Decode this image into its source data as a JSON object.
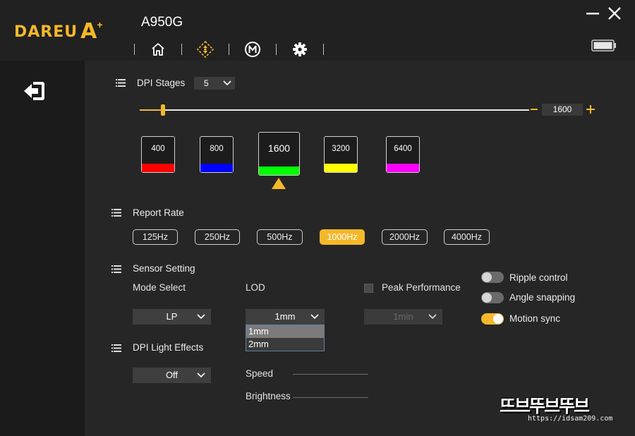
{
  "brand": {
    "logo_text": "DAREU",
    "logo_mark": "A",
    "logo_plus": "+",
    "accent": "#f5b82a"
  },
  "header": {
    "model": "A950G"
  },
  "nav": [
    {
      "name": "home-icon"
    },
    {
      "name": "dpi-icon",
      "active": true
    },
    {
      "name": "macro-icon"
    },
    {
      "name": "settings-icon"
    }
  ],
  "dpi": {
    "label": "DPI Stages",
    "stage_count": "5",
    "current_value": "1600",
    "slider_fraction": 0.06,
    "stages": [
      {
        "value": "400",
        "color": "#ff0000"
      },
      {
        "value": "800",
        "color": "#0000ff"
      },
      {
        "value": "1600",
        "color": "#00ff00",
        "selected": true
      },
      {
        "value": "3200",
        "color": "#ffff00"
      },
      {
        "value": "6400",
        "color": "#ff00ff"
      }
    ]
  },
  "report_rate": {
    "label": "Report Rate",
    "options": [
      "125Hz",
      "250Hz",
      "500Hz",
      "1000Hz",
      "2000Hz",
      "4000Hz"
    ],
    "selected": "1000Hz"
  },
  "sensor": {
    "label": "Sensor Setting",
    "mode_label": "Mode Select",
    "mode_value": "LP",
    "lod_label": "LOD",
    "lod_value": "1mm",
    "lod_options": [
      "1mm",
      "2mm"
    ],
    "peak_label": "Peak Performance",
    "peak_checked": false,
    "peak_value": "1min"
  },
  "toggles": [
    {
      "label": "Ripple control",
      "on": false
    },
    {
      "label": "Angle snapping",
      "on": false
    },
    {
      "label": "Motion sync",
      "on": true
    }
  ],
  "light": {
    "label": "DPI Light Effects",
    "effect_value": "Off",
    "speed_label": "Speed",
    "brightness_label": "Brightness"
  },
  "watermark": {
    "title": "뜨브뚜브뚜브",
    "url": "https://idsam209.com"
  }
}
